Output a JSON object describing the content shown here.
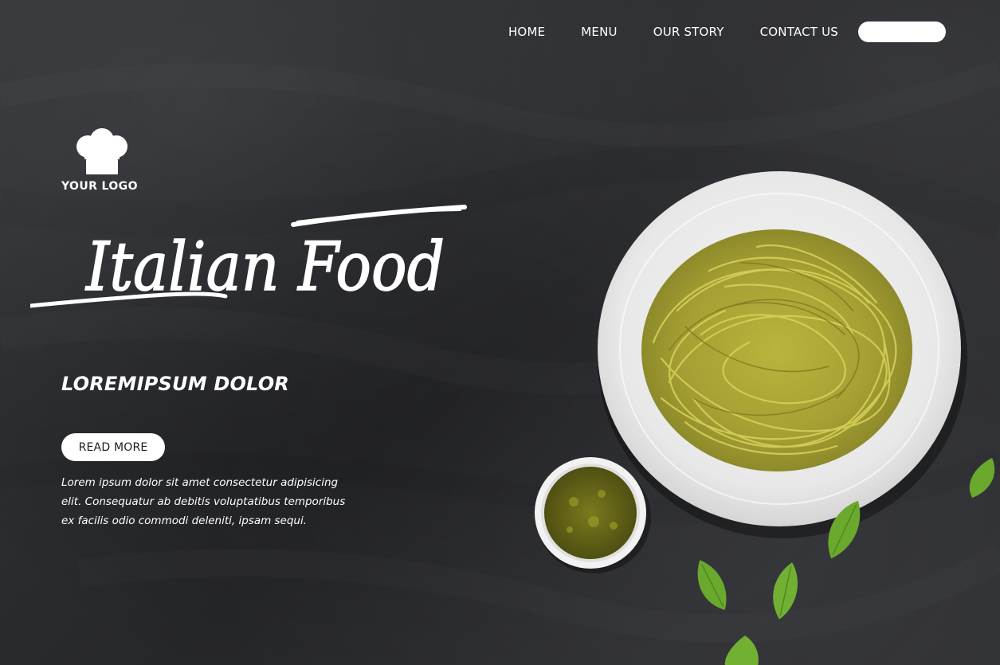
{
  "nav": {
    "items": [
      {
        "label": "HOME"
      },
      {
        "label": "MENU"
      },
      {
        "label": "OUR STORY"
      },
      {
        "label": "CONTACT US"
      }
    ],
    "pill_label": ""
  },
  "logo": {
    "icon": "chef-hat-icon",
    "text": "YOUR LOGO"
  },
  "hero": {
    "title": "Italian Food",
    "subtitle": "LOREMIPSUM DOLOR",
    "button_label": "READ MORE",
    "body": "Lorem ipsum dolor sit amet consectetur adipisicing elit. Consequatur ab debitis voluptatibus temporibus ex facilis odio commodi deleniti, ipsam sequi."
  },
  "colors": {
    "background": "#2b2c2f",
    "text": "#ffffff",
    "pasta": "#a9a336",
    "plate": "#f4f4f4",
    "basil": "#6aa82e"
  }
}
